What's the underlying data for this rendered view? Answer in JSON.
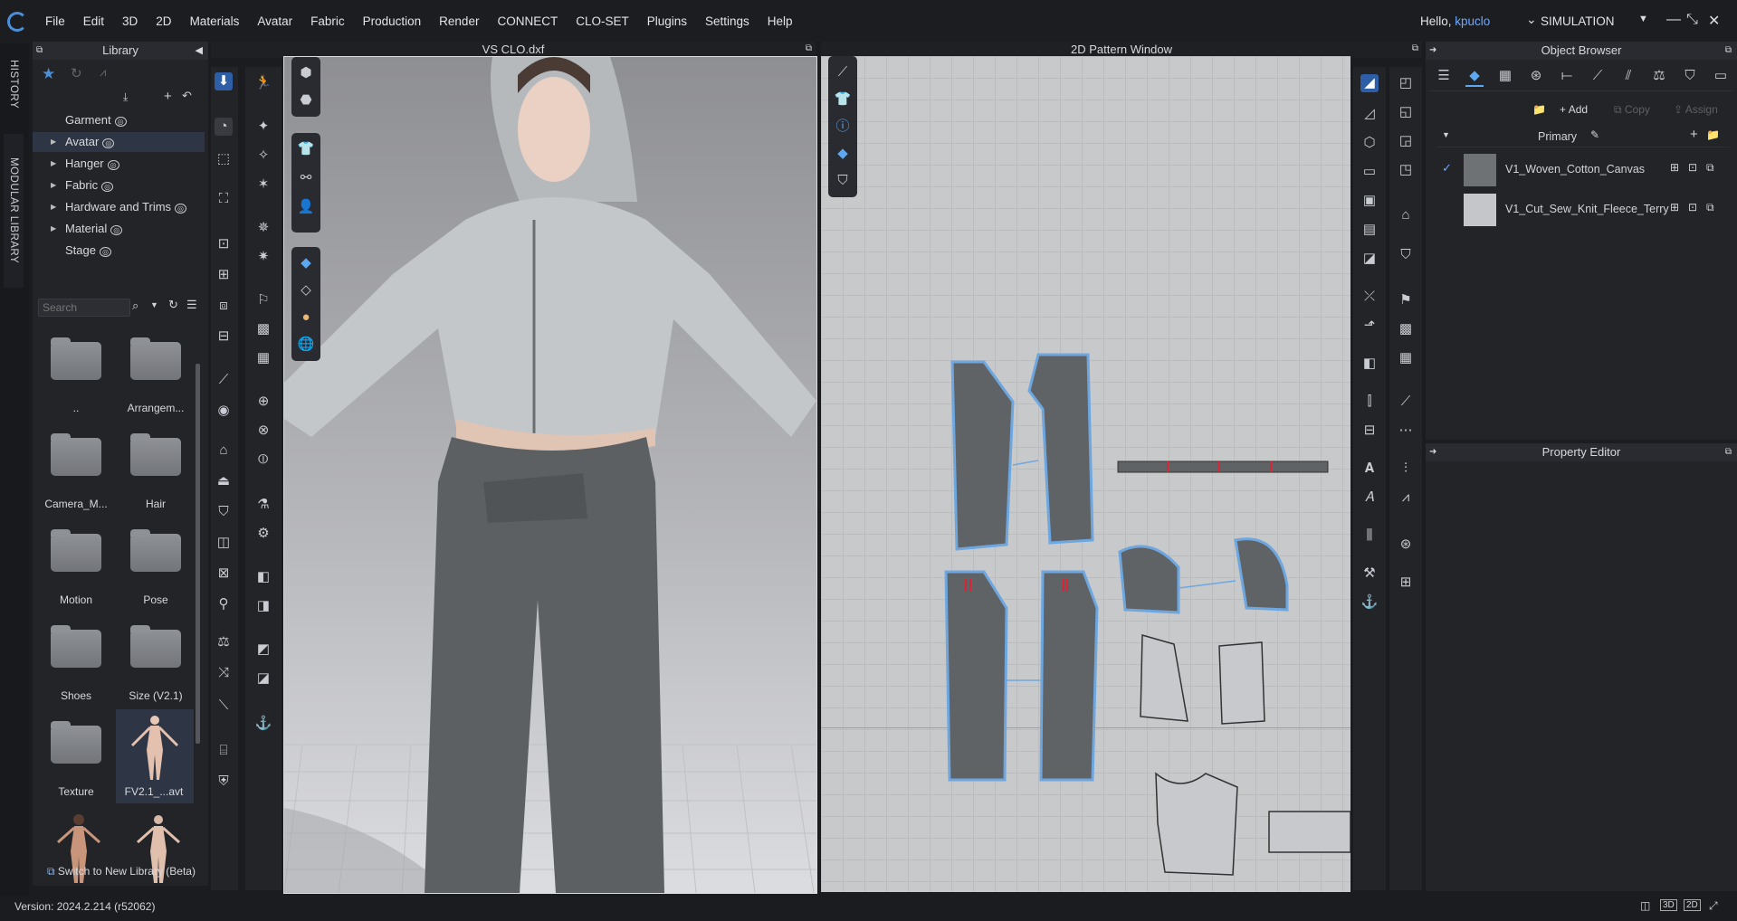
{
  "menubar": {
    "items": [
      "File",
      "Edit",
      "3D",
      "2D",
      "Materials",
      "Avatar",
      "Fabric",
      "Production",
      "Render",
      "CONNECT",
      "CLO-SET",
      "Plugins",
      "Settings",
      "Help"
    ],
    "greeting": "Hello, ",
    "username": "kpuclo",
    "mode": "SIMULATION"
  },
  "side_tabs": {
    "history": "HISTORY",
    "modular": "MODULAR LIBRARY"
  },
  "library": {
    "title": "Library",
    "tree": [
      "Garment",
      "Avatar",
      "Hanger",
      "Fabric",
      "Hardware and Trims",
      "Material",
      "Stage"
    ],
    "search_placeholder": "Search",
    "folders": [
      "..",
      "Arrangem...",
      "Camera_M...",
      "Hair",
      "Motion",
      "Pose",
      "Shoes",
      "Size (V2.1)",
      "Texture",
      "FV2.1_...avt"
    ],
    "switch_label": "Switch to New Library (Beta)"
  },
  "view3d": {
    "title": "VS CLO.dxf"
  },
  "view2d": {
    "title": "2D Pattern Window"
  },
  "object_browser": {
    "title": "Object Browser",
    "add": "Add",
    "copy": "Copy",
    "assign": "Assign",
    "group": "Primary",
    "fabrics": [
      {
        "name": "V1_Woven_Cotton_Canvas",
        "swatch": "#6f7275",
        "checked": true
      },
      {
        "name": "V1_Cut_Sew_Knit_Fleece_Terry",
        "swatch": "#c4c6c9",
        "checked": false
      }
    ]
  },
  "property_editor": {
    "title": "Property Editor"
  },
  "status": {
    "version": "Version: 2024.2.214 (r52062)",
    "view_buttons": [
      "3D",
      "2D"
    ]
  }
}
